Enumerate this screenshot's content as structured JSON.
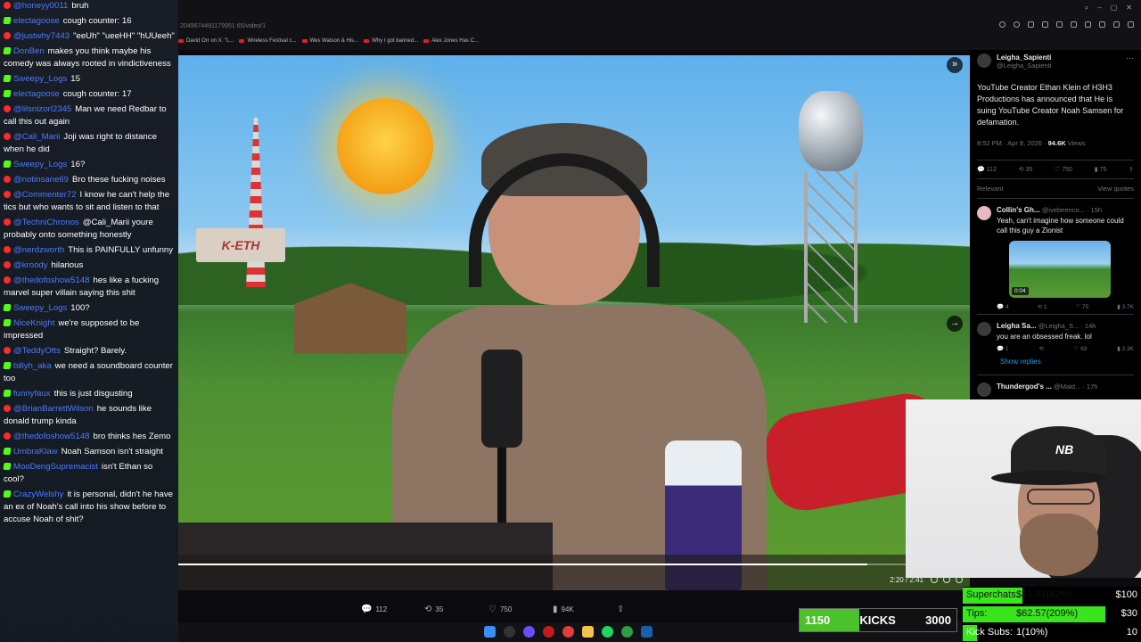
{
  "browser": {
    "url_fragment": "2049674491179951 65/video/1",
    "bookmarks": [
      "David Orr on X: \"L...",
      "Wireless Festival c...",
      "Wes Watson & His...",
      "Why I got banned...",
      "Alex Jones Has C..."
    ]
  },
  "chat": {
    "messages": [
      {
        "platform": "yt",
        "user": "@honeyy0011",
        "text": "bruh"
      },
      {
        "platform": "kick",
        "user": "electagoose",
        "text": "cough counter: 16"
      },
      {
        "platform": "yt",
        "user": "@justwhy7443",
        "text": "\"eeUh\" \"ueeHH\" \"hUUeeh\""
      },
      {
        "platform": "kick",
        "user": "DonBen",
        "text": "makes you think maybe his comedy was always rooted in vindictiveness"
      },
      {
        "platform": "kick",
        "user": "Sweepy_Logs",
        "text": "15"
      },
      {
        "platform": "kick",
        "user": "electagoose",
        "text": "cough counter: 17"
      },
      {
        "platform": "yt",
        "user": "@lilsnizorl2345",
        "text": "Man we need Redbar to call this out again"
      },
      {
        "platform": "yt",
        "user": "@Cali_Marii",
        "text": "Joji was right to distance when he did"
      },
      {
        "platform": "kick",
        "user": "Sweepy_Logs",
        "text": "16?"
      },
      {
        "platform": "yt",
        "user": "@notinsane69",
        "text": "Bro these fucking noises"
      },
      {
        "platform": "yt",
        "user": "@Commenter72",
        "text": "I know he can't help the tics but who wants to sit and listen to that"
      },
      {
        "platform": "yt",
        "user": "@TechniChronos",
        "text": "@Cali_Marii youre probably onto something honestly"
      },
      {
        "platform": "yt",
        "user": "@nerdzworth",
        "text": "This is PAINFULLY unfunny"
      },
      {
        "platform": "yt",
        "user": "@kroody",
        "text": "hilarious"
      },
      {
        "platform": "yt",
        "user": "@thedofoshow5148",
        "text": "hes like a fucking marvel super villain saying this shit"
      },
      {
        "platform": "kick",
        "user": "Sweepy_Logs",
        "text": "100?"
      },
      {
        "platform": "kick",
        "user": "NiceKnight",
        "text": "we're supposed to be impressed"
      },
      {
        "platform": "yt",
        "user": "@TeddyOtts",
        "text": "Straight? Barely."
      },
      {
        "platform": "kick",
        "user": "billyh_aka",
        "text": "we need a soundboard counter too"
      },
      {
        "platform": "kick",
        "user": "funnyfaux",
        "text": "this is just disgusting"
      },
      {
        "platform": "yt",
        "user": "@BrianBarrettWilson",
        "text": "he sounds like donald trump kinda"
      },
      {
        "platform": "yt",
        "user": "@thedofoshow5148",
        "text": "bro thinks hes Zemo"
      },
      {
        "platform": "kick",
        "user": "UmbraKlaw",
        "text": "Noah Samson isn't straight"
      },
      {
        "platform": "kick",
        "user": "MooDengSupremacist",
        "text": "isn't Ethan so cool?"
      },
      {
        "platform": "kick",
        "user": "CrazyWelshy",
        "text": "it is personal, didn't he have an ex of Noah's call into his show before to accuse Noah of shit?"
      }
    ]
  },
  "video": {
    "sign_text": "K-ETH",
    "time": "2:20 / 2:41",
    "progress": 0.87,
    "metrics": {
      "replies": "112",
      "reposts": "35",
      "likes": "750",
      "views": "94K"
    }
  },
  "xpost": {
    "name": "Leigha_Sapienti",
    "handle": "@Leigha_Sapienti",
    "text": "YouTube Creator Ethan Klein of H3H3 Productions has announced that He is suing YouTube Creator Noah Samsen for defamation.",
    "time": "8:52 PM · Apr 8, 2026 ·",
    "views": "94.6K",
    "views_label": "Views",
    "stats": [
      "112",
      "35",
      "750",
      "75"
    ],
    "relevant": "Relevant",
    "view_quotes": "View quotes",
    "replies": [
      {
        "name": "Collin's Gh...",
        "handle": "@ivebeenco... · 15h",
        "text": "Yeah, can't imagine how someone could call this guy a Zionist",
        "duration": "0:04",
        "stats": [
          "4",
          "1",
          "75",
          "3.7K"
        ]
      },
      {
        "name": "Leigha Sa...",
        "handle": "@Leigha_S... · 14h",
        "text": "you are an obsessed freak. lol",
        "stats": [
          "1",
          "",
          "63",
          "2.3K"
        ]
      }
    ],
    "show_replies": "Show replies",
    "third_name": "Thundergod's ...",
    "third_handle": "@Mald... · 17h"
  },
  "goals": {
    "kicks_current": "1150",
    "kicks_label": "KICKS",
    "kicks_target": "3000",
    "kicks_progress": 0.38,
    "rows": [
      {
        "label": "Superchats:",
        "value": "$41.91(42%)",
        "target": "$100",
        "progress": 0.42
      },
      {
        "label": "Tips:",
        "value": "$62.57(209%)",
        "target": "$30",
        "progress": 1.0
      },
      {
        "label": "Kick Subs:",
        "value": "1(10%)",
        "target": "10",
        "progress": 0.1
      }
    ]
  },
  "colors": {
    "kick_green": "#53fc18",
    "yt_red": "#ff2a2a",
    "user_blue": "#4c7bff",
    "x_link": "#1d9bf0"
  }
}
